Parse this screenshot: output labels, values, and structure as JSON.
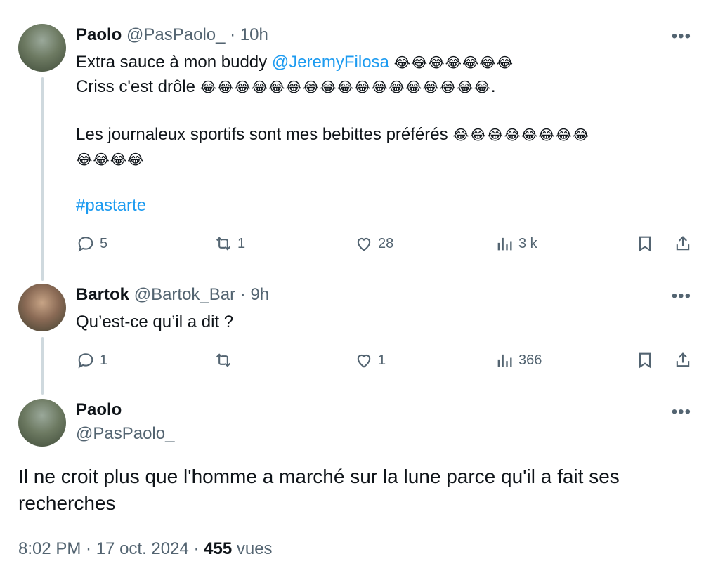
{
  "tweet1": {
    "name": "Paolo",
    "handle": "@PasPaolo_",
    "time": "· 10h",
    "line1": "Extra sauce à mon buddy ",
    "mention": "@JeremyFilosa",
    "line1_emoji": "😂😂😂😂😂😂😂",
    "line2": "Criss c'est drôle ",
    "line2_emoji": "😂😂😂😂😂😂😂😂😂😂😂😂😂😂😂😂😂",
    "line2_end": ".",
    "line3": "Les journaleux sportifs sont mes bebittes préférés ",
    "line3_emoji": "😂😂😂😂😂😂😂😂",
    "line4_emoji": "😂😂😂😂",
    "hashtag": "#pastarte",
    "replies": "5",
    "retweets": "1",
    "likes": "28",
    "views": "3 k"
  },
  "tweet2": {
    "name": "Bartok",
    "handle": "@Bartok_Bar",
    "time": "· 9h",
    "text": "Qu’est-ce qu’il a dit ?",
    "replies": "1",
    "retweets": "",
    "likes": "1",
    "views": "366"
  },
  "tweet3": {
    "name": "Paolo",
    "handle": "@PasPaolo_",
    "text": "Il ne croit plus que l'homme a marché sur la lune parce qu'il a fait ses recherches",
    "time": "8:02 PM · 17 oct. 2024 · ",
    "views": "455",
    "views_label": " vues"
  },
  "more_glyph": "•••",
  "colors": {
    "link": "#1d9bf0",
    "secondary": "#536471",
    "thread_line": "#cfd9de"
  }
}
